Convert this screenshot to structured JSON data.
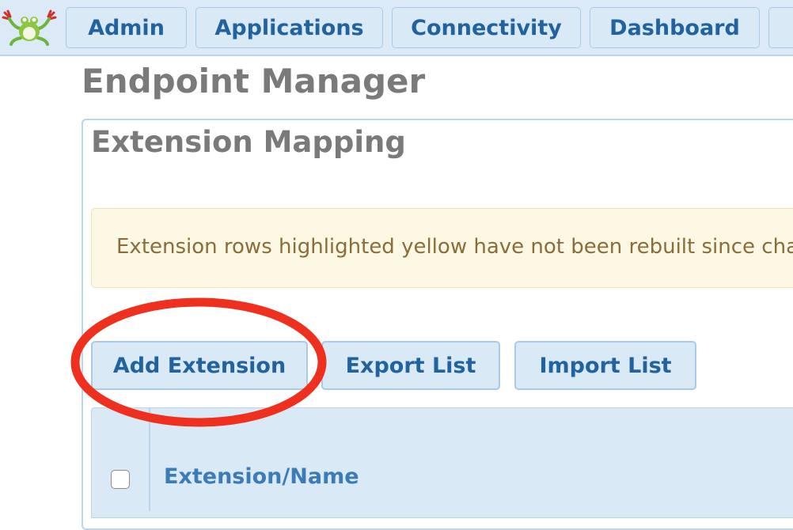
{
  "nav": {
    "items": [
      {
        "label": "Admin"
      },
      {
        "label": "Applications"
      },
      {
        "label": "Connectivity"
      },
      {
        "label": "Dashboard"
      },
      {
        "label": ""
      }
    ]
  },
  "page": {
    "title": "Endpoint Manager"
  },
  "section": {
    "title": "Extension Mapping"
  },
  "alert": {
    "text": "Extension rows highlighted yellow have not been rebuilt since cha"
  },
  "actions": {
    "add_label": "Add Extension",
    "export_label": "Export List",
    "import_label": "Import List"
  },
  "table": {
    "columns": [
      {
        "label": "Extension/Name"
      }
    ]
  },
  "colors": {
    "nav_bg": "#dbeaf6",
    "button_bg": "#d9e9f6",
    "button_text": "#21639f",
    "alert_bg": "#fcf8e3",
    "alert_text": "#8a6d3b",
    "highlight": "#f0301f"
  }
}
